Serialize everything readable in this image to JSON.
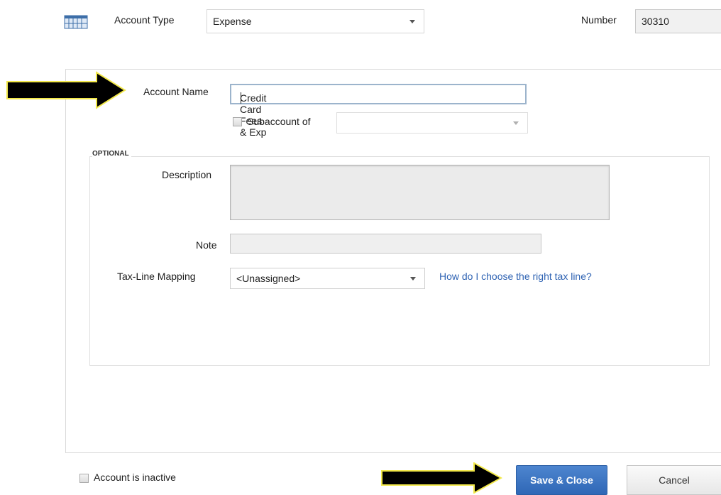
{
  "header": {
    "account_type_label": "Account Type",
    "account_type_value": "Expense",
    "number_label": "Number",
    "number_value": "30310"
  },
  "form": {
    "account_name_label": "Account Name",
    "account_name_value": "Credit Card Fees & Exp",
    "subaccount_label": "Subaccount of",
    "subaccount_checked": false,
    "subaccount_value": "",
    "optional_title": "OPTIONAL",
    "description_label": "Description",
    "description_value": "",
    "note_label": "Note",
    "note_value": "",
    "tax_line_label": "Tax-Line Mapping",
    "tax_line_value": "<Unassigned>",
    "tax_help_link": "How do I choose the right tax line?"
  },
  "footer": {
    "inactive_label": "Account is inactive",
    "inactive_checked": false,
    "save_label": "Save & Close",
    "cancel_label": "Cancel"
  },
  "colors": {
    "accent": "#2f67b6",
    "link": "#2f63b3",
    "annotation_arrow": "#000000",
    "annotation_arrow_outline": "#f2e84a"
  },
  "icons": [
    "account-grid-icon",
    "dropdown-arrow-icon",
    "annotation-arrow-icon"
  ]
}
